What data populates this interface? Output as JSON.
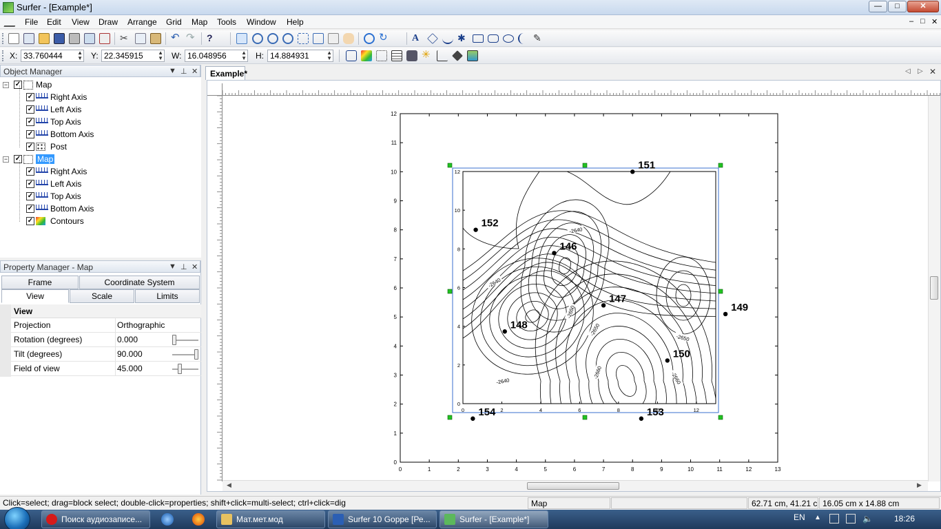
{
  "window": {
    "app_icon": "surfer-app-icon",
    "title": "Surfer - [Example*]",
    "minimize": "—",
    "maximize": "□",
    "close": "✕"
  },
  "menu": [
    "File",
    "Edit",
    "View",
    "Draw",
    "Arrange",
    "Grid",
    "Map",
    "Tools",
    "Window",
    "Help"
  ],
  "mdi_controls": [
    "–",
    "□",
    "✕"
  ],
  "coords": {
    "x_label": "X:",
    "x_value": "33.760444",
    "y_label": "Y:",
    "y_value": "22.345915",
    "w_label": "W:",
    "w_value": "16.048956",
    "h_label": "H:",
    "h_value": "14.884931"
  },
  "object_manager": {
    "title": "Object Manager",
    "items": [
      {
        "label": "Map",
        "level": 0,
        "icon": "map-frame-icon",
        "selected": false
      },
      {
        "label": "Right Axis",
        "level": 1,
        "icon": "axis-icon"
      },
      {
        "label": "Left Axis",
        "level": 1,
        "icon": "axis-icon"
      },
      {
        "label": "Top Axis",
        "level": 1,
        "icon": "axis-icon"
      },
      {
        "label": "Bottom Axis",
        "level": 1,
        "icon": "axis-icon"
      },
      {
        "label": "Post",
        "level": 1,
        "icon": "post-layer-icon"
      },
      {
        "label": "Map",
        "level": 0,
        "icon": "map-frame-icon",
        "selected": true
      },
      {
        "label": "Right Axis",
        "level": 1,
        "icon": "axis-icon"
      },
      {
        "label": "Left Axis",
        "level": 1,
        "icon": "axis-icon"
      },
      {
        "label": "Top Axis",
        "level": 1,
        "icon": "axis-icon"
      },
      {
        "label": "Bottom Axis",
        "level": 1,
        "icon": "axis-icon"
      },
      {
        "label": "Contours",
        "level": 1,
        "icon": "contour-layer-icon"
      }
    ]
  },
  "property_manager": {
    "title": "Property Manager - Map",
    "tabs_row1": [
      "Frame",
      "Coordinate System"
    ],
    "tabs_row2": [
      "View",
      "Scale",
      "Limits"
    ],
    "active_tab": "View",
    "section": "View",
    "rows": [
      {
        "name": "Projection",
        "value": "Orthographic"
      },
      {
        "name": "Rotation (degrees)",
        "value": "0.000",
        "slider": 0.0
      },
      {
        "name": "Tilt (degrees)",
        "value": "90.000",
        "slider": 1.0
      },
      {
        "name": "Field of view",
        "value": "45.000",
        "slider": 0.25
      }
    ]
  },
  "document": {
    "tab": "Example*"
  },
  "map": {
    "outer_axis": {
      "x_ticks": [
        0,
        1,
        2,
        3,
        4,
        5,
        6,
        7,
        8,
        9,
        10,
        11,
        12,
        13
      ],
      "y_ticks": [
        0,
        1,
        2,
        3,
        4,
        5,
        6,
        7,
        8,
        9,
        10,
        11,
        12
      ]
    },
    "inner_axis": {
      "x_ticks": [
        0,
        2,
        4,
        6,
        8,
        10,
        12
      ],
      "y_ticks": [
        0,
        2,
        4,
        6,
        8,
        10,
        12
      ]
    },
    "posts": [
      {
        "label": "151",
        "x": 8.0,
        "y": 10.0
      },
      {
        "label": "152",
        "x": 2.6,
        "y": 8.0
      },
      {
        "label": "146",
        "x": 5.3,
        "y": 7.2
      },
      {
        "label": "147",
        "x": 7.0,
        "y": 5.4
      },
      {
        "label": "149",
        "x": 11.2,
        "y": 5.1
      },
      {
        "label": "148",
        "x": 3.6,
        "y": 4.5
      },
      {
        "label": "150",
        "x": 9.2,
        "y": 3.5
      },
      {
        "label": "154",
        "x": 2.5,
        "y": 1.5
      },
      {
        "label": "153",
        "x": 8.3,
        "y": 1.5
      }
    ],
    "contour_labels": [
      "-2640",
      "-2640",
      "-2640",
      "-2650",
      "-2650",
      "-2650",
      "-2660",
      "-2660"
    ]
  },
  "status": {
    "hint": "Click=select; drag=block select; double-click=properties; shift+click=multi-select; ctrl+click=dig",
    "object": "Map",
    "empty": "",
    "position": "62.71 cm, 41.21 cm",
    "size": "16.05 cm x 14.88 cm"
  },
  "taskbar": {
    "buttons": [
      {
        "label": "Поиск аудиозаписе...",
        "icon": "opera-icon",
        "color": "#d61a1a"
      },
      {
        "label": "Мат.мет.мод",
        "icon": "folder-icon",
        "color": "#e8c260"
      },
      {
        "label": "Surfer 10 Goppe [Ре...",
        "icon": "word-icon",
        "color": "#2b5fb4"
      },
      {
        "label": "Surfer - [Example*]",
        "icon": "surfer-icon",
        "color": "#5cb85c"
      }
    ],
    "lang": "EN",
    "time": "18:26"
  }
}
